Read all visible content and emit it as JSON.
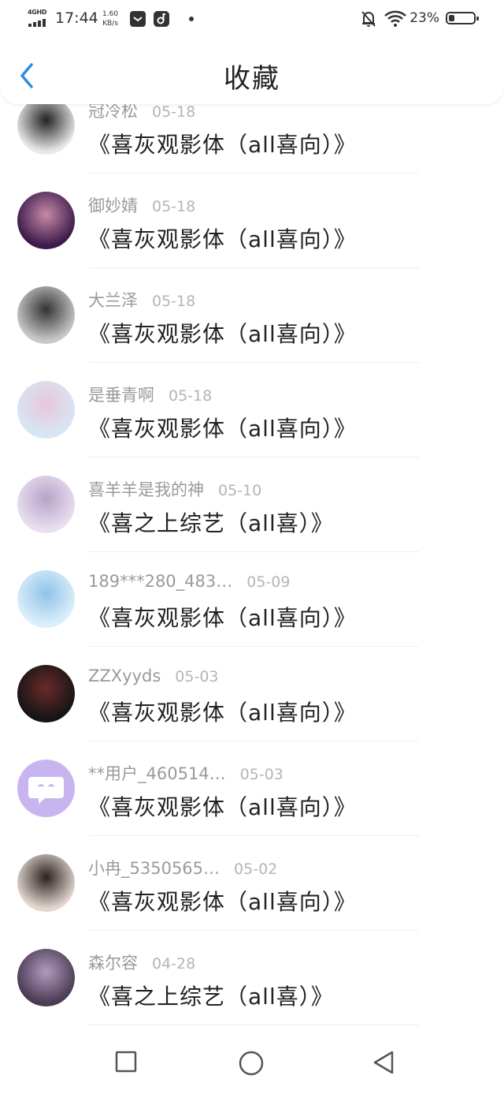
{
  "status_bar": {
    "network": "4GHD",
    "time": "17:44",
    "speed_value": "1.60",
    "speed_unit": "KB/s",
    "battery": "23%",
    "battery_level": 0.23
  },
  "header": {
    "title": "收藏"
  },
  "items": [
    {
      "user": "冠冷松",
      "date": "05-18",
      "title": "《喜灰观影体（all喜向）》",
      "avatar_color": "#e8e8e8",
      "avatar_accent": "#222222"
    },
    {
      "user": "御妙婧",
      "date": "05-18",
      "title": "《喜灰观影体（all喜向）》",
      "avatar_color": "#3a1a4a",
      "avatar_accent": "#c98aa8"
    },
    {
      "user": "大兰泽",
      "date": "05-18",
      "title": "《喜灰观影体（all喜向）》",
      "avatar_color": "#c8c8c8",
      "avatar_accent": "#333333"
    },
    {
      "user": "是垂青啊",
      "date": "05-18",
      "title": "《喜灰观影体（all喜向）》",
      "avatar_color": "#d7e6f4",
      "avatar_accent": "#e8c7d8"
    },
    {
      "user": "喜羊羊是我的神",
      "date": "05-10",
      "title": "《喜之上综艺（all喜）》",
      "avatar_color": "#e9dff0",
      "avatar_accent": "#b7a3c8"
    },
    {
      "user": "189***280_483…",
      "date": "05-09",
      "title": "《喜灰观影体（all喜向）》",
      "avatar_color": "#dceffa",
      "avatar_accent": "#8fc3e8"
    },
    {
      "user": "ZZXyyds",
      "date": "05-03",
      "title": "《喜灰观影体（all喜向）》",
      "avatar_color": "#151515",
      "avatar_accent": "#6a2a2a"
    },
    {
      "user": "**用户_460514…",
      "date": "05-03",
      "title": "《喜灰观影体（all喜向）》",
      "avatar_color": "#c8b5f0",
      "avatar_accent": "#ffffff"
    },
    {
      "user": "小冉_5350565…",
      "date": "05-02",
      "title": "《喜灰观影体（all喜向）》",
      "avatar_color": "#e2d6cf",
      "avatar_accent": "#2a2220"
    },
    {
      "user": "森尔容",
      "date": "04-28",
      "title": "《喜之上综艺（all喜）》",
      "avatar_color": "#4a3a52",
      "avatar_accent": "#b19ac0"
    }
  ],
  "nav": {
    "buttons": [
      "recents",
      "home",
      "back"
    ]
  },
  "colors": {
    "accent": "#2f8de4",
    "text_secondary": "#9a9a9a",
    "chat_bubble": "#c8b5f0"
  }
}
